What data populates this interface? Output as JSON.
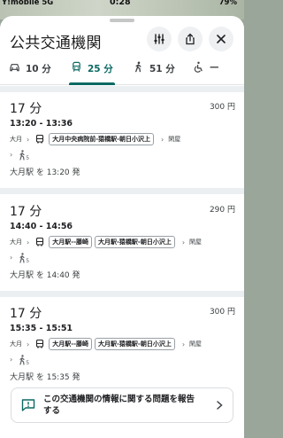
{
  "status_bar": {
    "carrier": "Y!mobile  5G",
    "time": "0:28",
    "battery": "79%"
  },
  "header": {
    "title": "公共交通機関"
  },
  "tabs": [
    {
      "label": "10 分",
      "icon": "car-icon",
      "active": false
    },
    {
      "label": "25 分",
      "icon": "train-icon",
      "active": true
    },
    {
      "label": "51 分",
      "icon": "walk-icon",
      "active": false
    },
    {
      "label": "—",
      "icon": "wheelchair-icon",
      "active": false
    }
  ],
  "routes": [
    {
      "duration": "17 分",
      "price": "300 円",
      "times": "13:20 - 13:36",
      "origin": "大月",
      "line_chips": [
        "大月中央病院前-猿橋駅-朝日小沢上"
      ],
      "destination": "閑屋",
      "walk_minutes": "5",
      "departure": "大月駅 を 13:20 発"
    },
    {
      "duration": "17 分",
      "price": "290 円",
      "times": "14:40 - 14:56",
      "origin": "大月",
      "line_chips": [
        "大月駅--藤崎",
        "大月駅-猿橋駅-朝日小沢上"
      ],
      "destination": "閑屋",
      "walk_minutes": "5",
      "departure": "大月駅 を 14:40 発"
    },
    {
      "duration": "17 分",
      "price": "300 円",
      "times": "15:35 - 15:51",
      "origin": "大月",
      "line_chips": [
        "大月駅--藤崎",
        "大月駅-猿橋駅-朝日小沢上"
      ],
      "destination": "閑屋",
      "walk_minutes": "5",
      "departure": "大月駅 を 15:35 発"
    }
  ],
  "report": {
    "text": "この交通機関の情報に関する問題を報告する"
  },
  "colors": {
    "accent": "#0b6a63",
    "divider": "#eceff1"
  }
}
